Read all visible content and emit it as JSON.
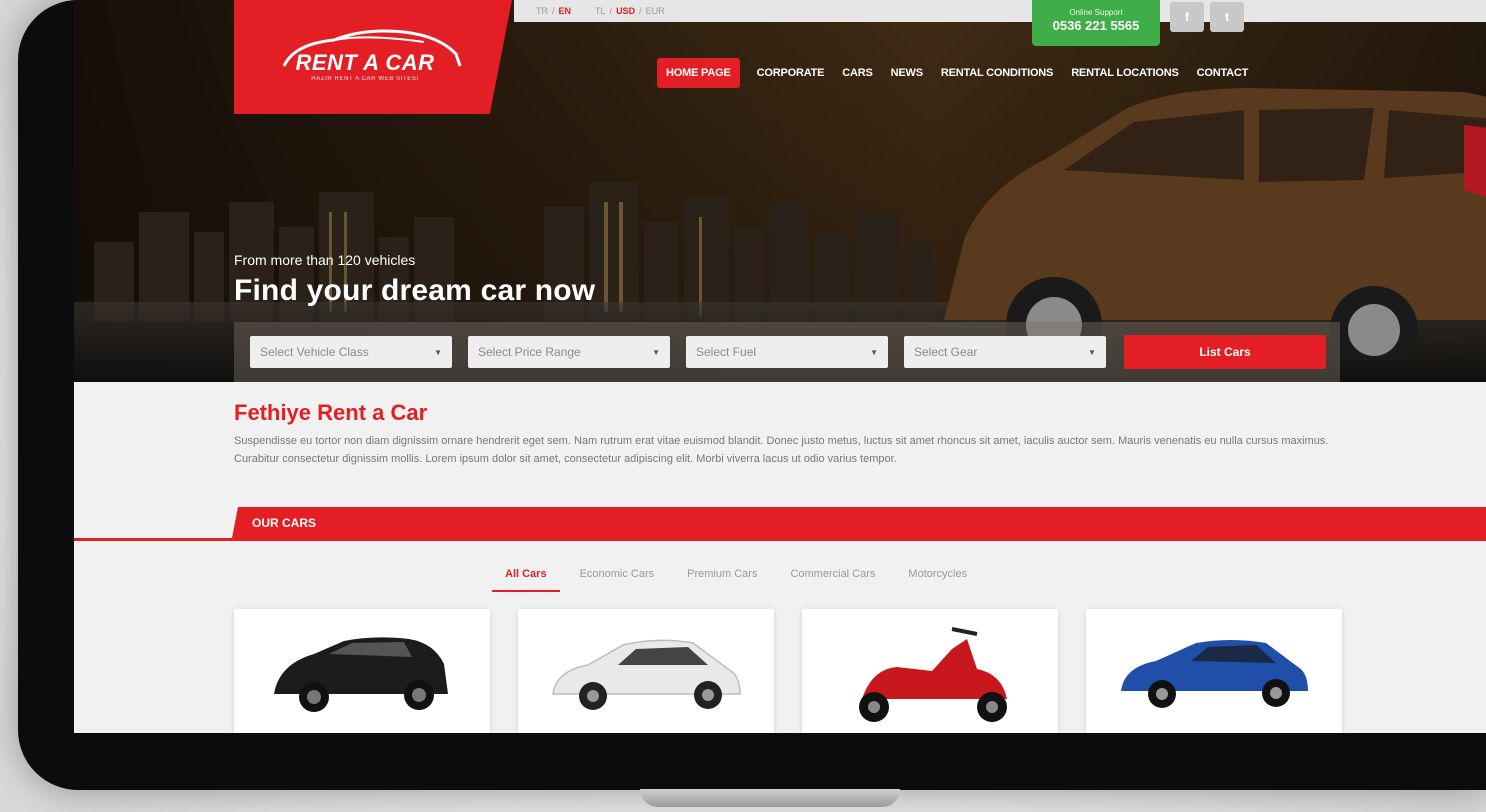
{
  "topbar": {
    "lang_1": "TR",
    "lang_2": "EN",
    "currency_1": "TL",
    "currency_2": "USD",
    "currency_3": "EUR",
    "divider": "/"
  },
  "support": {
    "label": "Online Support",
    "phone": "0536 221 5565"
  },
  "social": {
    "facebook": "f",
    "twitter": "t"
  },
  "logo": {
    "title": "RENT A CAR",
    "subtitle": "HAZIR RENT A CAR WEB SITESI"
  },
  "nav": {
    "items": [
      "HOME PAGE",
      "CORPORATE",
      "CARS",
      "NEWS",
      "RENTAL CONDITIONS",
      "RENTAL LOCATIONS",
      "CONTACT"
    ]
  },
  "hero": {
    "tagline": "From more than 120 vehicles",
    "headline": "Find your dream car now"
  },
  "search": {
    "vehicle_class": "Select Vehicle Class",
    "price_range": "Select Price Range",
    "fuel": "Select Fuel",
    "gear": "Select Gear",
    "button": "List Cars",
    "caret": "▼"
  },
  "intro": {
    "title": "Fethiye Rent a Car",
    "text": "Suspendisse eu tortor non diam dignissim ornare hendrerit eget sem. Nam rutrum erat vitae euismod blandit. Donec justo metus, luctus sit amet rhoncus sit amet, iaculis auctor sem. Mauris venenatis eu nulla cursus maximus. Curabitur consectetur dignissim mollis. Lorem ipsum dolor sit amet, consectetur adipiscing elit. Morbi viverra lacus ut odio varius tempor."
  },
  "our_cars": {
    "label": "OUR CARS",
    "tabs": [
      "All Cars",
      "Economic Cars",
      "Premium Cars",
      "Commercial Cars",
      "Motorcycles"
    ]
  },
  "colors": {
    "brand_red": "#e31e24",
    "support_green": "#3fae49"
  },
  "cards": [
    {
      "icon": "black-suv-image"
    },
    {
      "icon": "white-sedan-image"
    },
    {
      "icon": "red-scooter-image"
    },
    {
      "icon": "blue-sedan-image"
    }
  ]
}
